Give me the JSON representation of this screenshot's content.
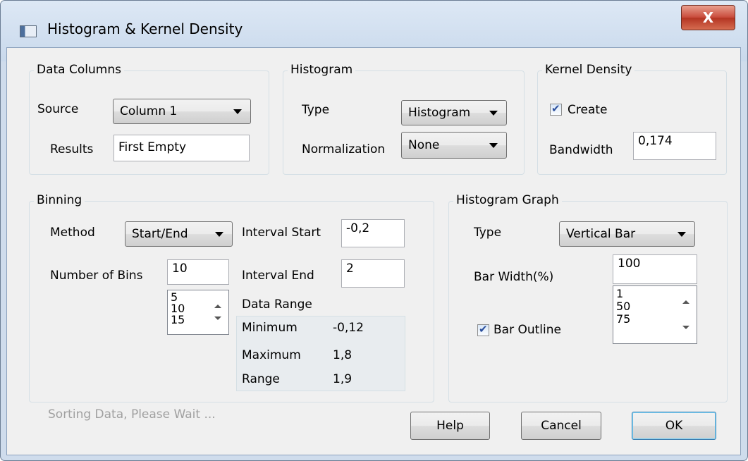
{
  "window": {
    "title": "Histogram & Kernel Density",
    "close_label": "X"
  },
  "data_columns": {
    "legend": "Data Columns",
    "source_label": "Source",
    "source_value": "Column 1",
    "results_label": "Results",
    "results_value": "First Empty"
  },
  "histogram": {
    "legend": "Histogram",
    "type_label": "Type",
    "type_value": "Histogram",
    "normalization_label": "Normalization",
    "normalization_value": "None"
  },
  "kernel_density": {
    "legend": "Kernel Density",
    "create_label": "Create",
    "create_checked": true,
    "bandwidth_label": "Bandwidth",
    "bandwidth_value": "0,174"
  },
  "binning": {
    "legend": "Binning",
    "method_label": "Method",
    "method_value": "Start/End",
    "num_bins_label": "Number of Bins",
    "num_bins_value": "10",
    "bins_options": [
      "5",
      "10",
      "15"
    ],
    "interval_start_label": "Interval Start",
    "interval_start_value": "-0,2",
    "interval_end_label": "Interval End",
    "interval_end_value": "2",
    "data_range": {
      "title": "Data Range",
      "minimum_label": "Minimum",
      "minimum_value": "-0,12",
      "maximum_label": "Maximum",
      "maximum_value": "1,8",
      "range_label": "Range",
      "range_value": "1,9"
    }
  },
  "histogram_graph": {
    "legend": "Histogram Graph",
    "type_label": "Type",
    "type_value": "Vertical Bar",
    "bar_width_label": "Bar Width(%)",
    "bar_width_value": "100",
    "bar_width_options": [
      "1",
      "50",
      "75"
    ],
    "bar_outline_label": "Bar Outline",
    "bar_outline_checked": true
  },
  "footer": {
    "status": "Sorting Data, Please Wait ...",
    "help_label": "Help",
    "cancel_label": "Cancel",
    "ok_label": "OK"
  }
}
